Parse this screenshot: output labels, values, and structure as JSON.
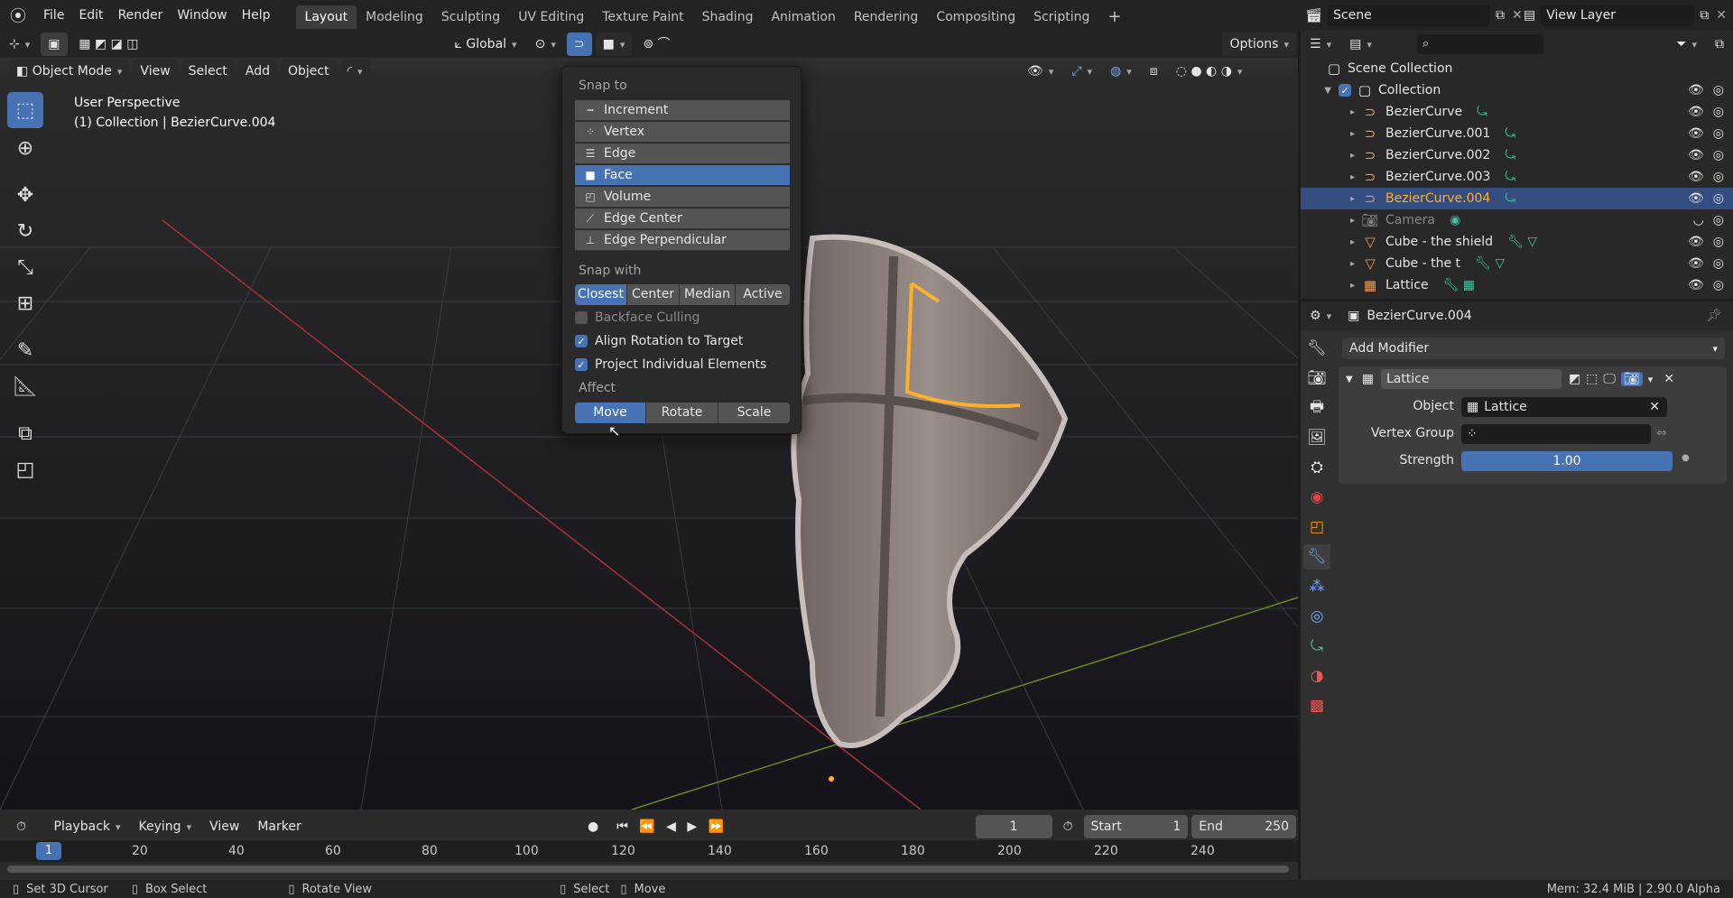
{
  "app": {
    "menus": [
      "File",
      "Edit",
      "Render",
      "Window",
      "Help"
    ]
  },
  "workspaces": [
    "Layout",
    "Modeling",
    "Sculpting",
    "UV Editing",
    "Texture Paint",
    "Shading",
    "Animation",
    "Rendering",
    "Compositing",
    "Scripting"
  ],
  "workspaces_active": "Layout",
  "top_right": {
    "scene": "Scene",
    "view_layer": "View Layer"
  },
  "tool_header": {
    "orientation": "Global",
    "options": "Options"
  },
  "viewport_header": {
    "mode": "Object Mode",
    "view": "View",
    "select": "Select",
    "add": "Add",
    "object": "Object"
  },
  "viewport_overlay": {
    "perspective": "User Perspective",
    "collection_info": "(1) Collection | BezierCurve.004"
  },
  "snap_popup": {
    "snap_to_label": "Snap to",
    "snap_to": [
      "Increment",
      "Vertex",
      "Edge",
      "Face",
      "Volume",
      "Edge Center",
      "Edge Perpendicular"
    ],
    "snap_to_selected": "Face",
    "snap_with_label": "Snap with",
    "snap_with": [
      "Closest",
      "Center",
      "Median",
      "Active"
    ],
    "snap_with_selected": "Closest",
    "options": [
      {
        "label": "Backface Culling",
        "checked": false
      },
      {
        "label": "Align Rotation to Target",
        "checked": true
      },
      {
        "label": "Project Individual Elements",
        "checked": true
      }
    ],
    "affect_label": "Affect",
    "affect": [
      "Move",
      "Rotate",
      "Scale"
    ],
    "affect_selected": "Move"
  },
  "timeline": {
    "menus": [
      "Playback",
      "Keying",
      "View",
      "Marker"
    ],
    "current_frame": "1",
    "start_label": "Start",
    "start": "1",
    "end_label": "End",
    "end": "250",
    "ruler": [
      "1",
      "20",
      "40",
      "60",
      "80",
      "100",
      "120",
      "140",
      "160",
      "180",
      "200",
      "220",
      "240"
    ]
  },
  "status_bar": {
    "left": [
      "Set 3D Cursor",
      "Box Select",
      "Rotate View",
      "Select",
      "Move"
    ],
    "right": "Mem: 32.4 MiB | 2.90.0 Alpha"
  },
  "outliner": {
    "root": "Scene Collection",
    "collection": "Collection",
    "items": [
      {
        "name": "BezierCurve",
        "icon": "curve-icon",
        "selected": false,
        "dim": false
      },
      {
        "name": "BezierCurve.001",
        "icon": "curve-icon",
        "selected": false,
        "dim": false
      },
      {
        "name": "BezierCurve.002",
        "icon": "curve-icon",
        "selected": false,
        "dim": false
      },
      {
        "name": "BezierCurve.003",
        "icon": "curve-icon",
        "selected": false,
        "dim": false
      },
      {
        "name": "BezierCurve.004",
        "icon": "curve-icon",
        "selected": true,
        "dim": false
      },
      {
        "name": "Camera",
        "icon": "camera-icon",
        "selected": false,
        "dim": true
      },
      {
        "name": "Cube - the shield",
        "icon": "mesh-icon",
        "selected": false,
        "dim": false
      },
      {
        "name": "Cube - the t",
        "icon": "mesh-icon",
        "selected": false,
        "dim": false
      },
      {
        "name": "Lattice",
        "icon": "lattice-icon",
        "selected": false,
        "dim": false
      }
    ]
  },
  "properties": {
    "object_name": "BezierCurve.004",
    "add_modifier": "Add Modifier",
    "modifier_name": "Lattice",
    "object_label": "Object",
    "object_value": "Lattice",
    "vertex_group_label": "Vertex Group",
    "strength_label": "Strength",
    "strength_value": "1.00"
  },
  "colors": {
    "accent": "#4772b3",
    "selected_orange": "#ffaf29",
    "curve_green": "#3fc4a0"
  }
}
